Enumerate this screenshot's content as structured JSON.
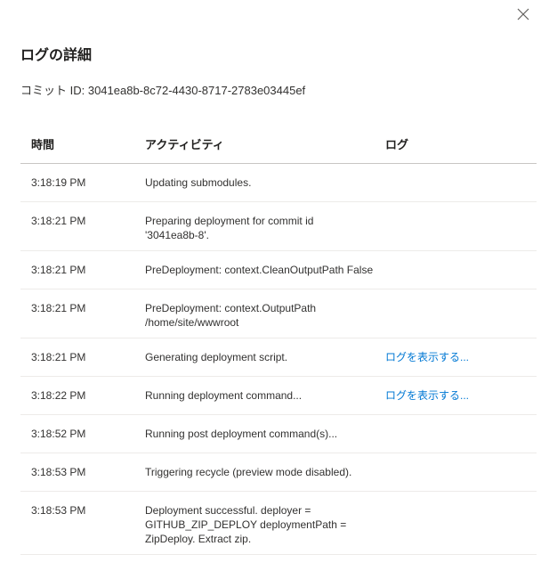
{
  "dialog": {
    "title": "ログの詳細",
    "commit_label": "コミット ID: 3041ea8b-8c72-4430-8717-2783e03445ef",
    "close_icon": "close-icon"
  },
  "table": {
    "headers": {
      "time": "時間",
      "activity": "アクティビティ",
      "log": "ログ"
    },
    "rows": [
      {
        "time": "3:18:19 PM",
        "activity": "Updating submodules.",
        "log": ""
      },
      {
        "time": "3:18:21 PM",
        "activity": "Preparing deployment for commit id\n'3041ea8b-8'.",
        "log": ""
      },
      {
        "time": "3:18:21 PM",
        "activity": "PreDeployment: context.CleanOutputPath False",
        "log": ""
      },
      {
        "time": "3:18:21 PM",
        "activity": "PreDeployment: context.OutputPath\n/home/site/wwwroot",
        "log": ""
      },
      {
        "time": "3:18:21 PM",
        "activity": "Generating deployment script.",
        "log": "ログを表示する..."
      },
      {
        "time": "3:18:22 PM",
        "activity": "Running deployment command...",
        "log": "ログを表示する..."
      },
      {
        "time": "3:18:52 PM",
        "activity": "Running post deployment command(s)...",
        "log": ""
      },
      {
        "time": "3:18:53 PM",
        "activity": "Triggering recycle (preview mode disabled).",
        "log": ""
      },
      {
        "time": "3:18:53 PM",
        "activity": "Deployment successful. deployer =\nGITHUB_ZIP_DEPLOY deploymentPath =\nZipDeploy. Extract zip.",
        "log": ""
      }
    ]
  },
  "colors": {
    "link": "#0078d4",
    "text": "#323130",
    "divider": "#edebe9"
  }
}
